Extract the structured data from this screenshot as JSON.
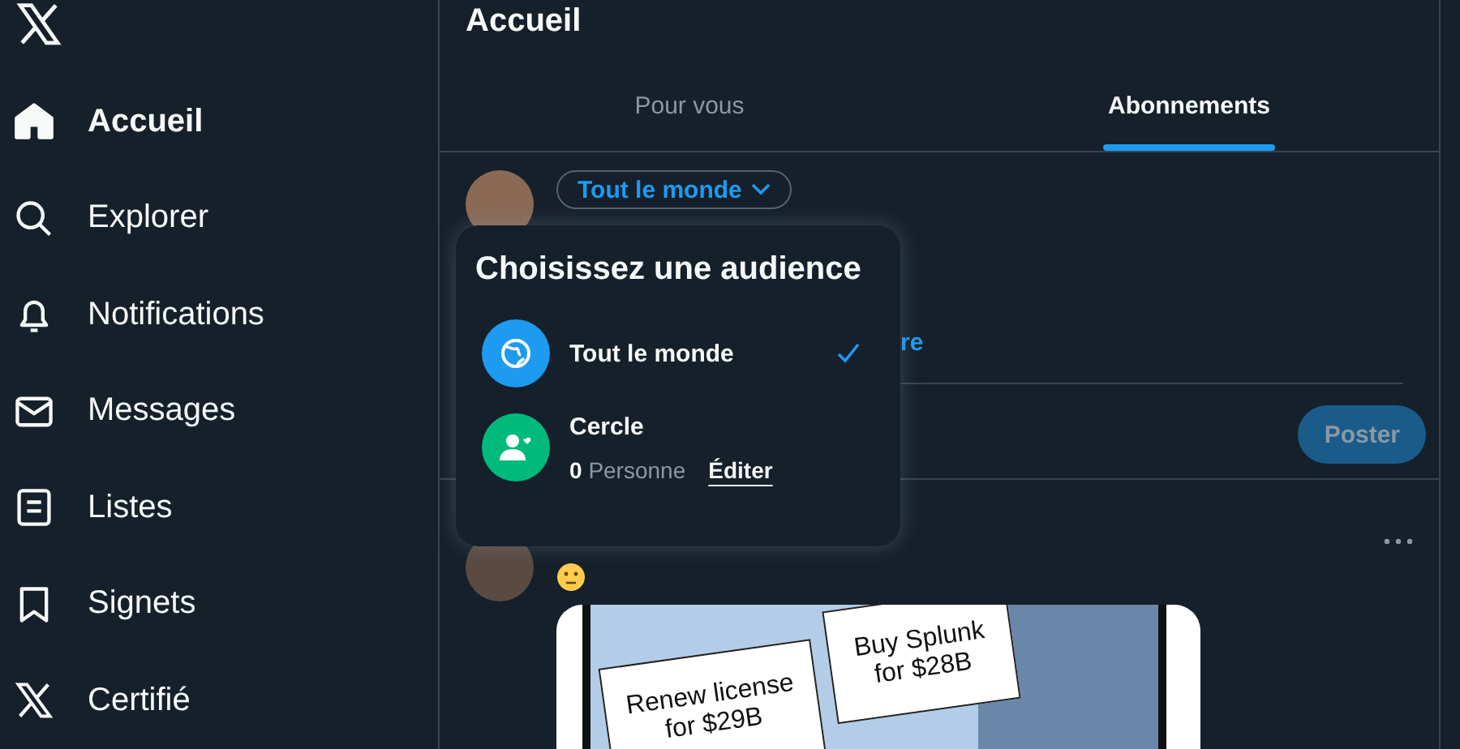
{
  "sidebar": {
    "items": [
      {
        "label": "Accueil",
        "kind": "home",
        "selected": true
      },
      {
        "label": "Explorer",
        "kind": "search",
        "selected": false
      },
      {
        "label": "Notifications",
        "kind": "bell",
        "selected": false
      },
      {
        "label": "Messages",
        "kind": "mail",
        "selected": false
      },
      {
        "label": "Listes",
        "kind": "list",
        "selected": false
      },
      {
        "label": "Signets",
        "kind": "bookmark",
        "selected": false
      },
      {
        "label": "Certifié",
        "kind": "x",
        "selected": false
      }
    ]
  },
  "header": {
    "title": "Accueil"
  },
  "tabs": [
    {
      "label": "Pour vous",
      "selected": false
    },
    {
      "label": "Abonnements",
      "selected": true
    }
  ],
  "composer": {
    "audience_button": "Tout le monde",
    "reply_setting": "re",
    "post_button": "Poster",
    "post_disabled": true
  },
  "audience_menu": {
    "title": "Choisissez une audience",
    "options": [
      {
        "kind": "globe",
        "label": "Tout le monde",
        "selected": true
      },
      {
        "kind": "circle",
        "label": "Cercle",
        "selected": false,
        "count": "0",
        "count_label": "Personne",
        "edit": "Éditer"
      }
    ]
  },
  "post": {
    "image_signs": [
      "Renew license for $29B",
      "Buy Splunk for $28B"
    ]
  }
}
